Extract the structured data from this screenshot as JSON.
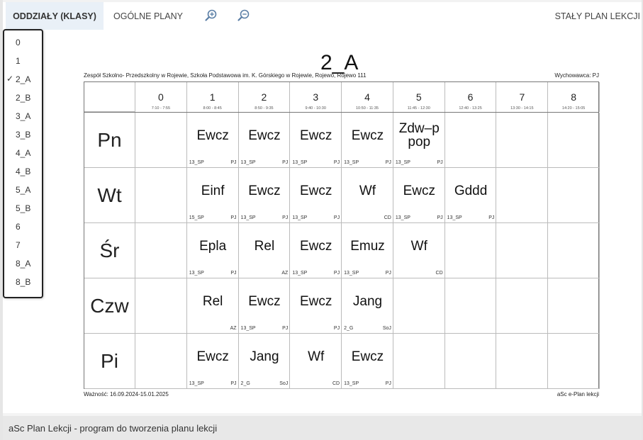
{
  "toolbar": {
    "tab_classes": "ODDZIAŁY (KLASY)",
    "tab_general": "OGÓLNE PLANY",
    "zoom_in_icon": "zoom-in-icon",
    "zoom_out_icon": "zoom-out-icon",
    "permanent_plan": "STAŁY PLAN LEKCJI",
    "accent": "#e9f0f7"
  },
  "dropdown": {
    "items": [
      "0",
      "1",
      "2_A",
      "2_B",
      "3_A",
      "3_B",
      "4_A",
      "4_B",
      "5_A",
      "5_B",
      "6",
      "7",
      "8_A",
      "8_B"
    ],
    "selected": "2_A",
    "check_mark": "✓"
  },
  "timetable": {
    "title": "2_A",
    "school": "Zespół Szkolno- Przedszkolny w Rojewie, Szkoła Podstawowa im. K. Górskiego w Rojewie, Rojewo, Rojewo 111",
    "form_teacher": "Wychowawca: PJ",
    "validity": "Ważność: 16.09.2024-15.01.2025",
    "brand": "aSc e-Plan lekcji",
    "periods": [
      {
        "num": "0",
        "time": "7:10 - 7:55"
      },
      {
        "num": "1",
        "time": "8:00 - 8:45"
      },
      {
        "num": "2",
        "time": "8:50 - 9:35"
      },
      {
        "num": "3",
        "time": "9:40 - 10:30"
      },
      {
        "num": "4",
        "time": "10:50 - 11:35"
      },
      {
        "num": "5",
        "time": "11:45 - 12:30"
      },
      {
        "num": "6",
        "time": "12:40 - 13:25"
      },
      {
        "num": "7",
        "time": "13:30 - 14:15"
      },
      {
        "num": "8",
        "time": "14:20 - 15:05"
      }
    ],
    "days": [
      {
        "name": "Pn",
        "lessons": [
          {
            "period": 1,
            "subject": "Ewcz",
            "room": "13_SP",
            "teacher": "PJ"
          },
          {
            "period": 2,
            "subject": "Ewcz",
            "room": "13_SP",
            "teacher": "PJ"
          },
          {
            "period": 3,
            "subject": "Ewcz",
            "room": "13_SP",
            "teacher": "PJ"
          },
          {
            "period": 4,
            "subject": "Ewcz",
            "room": "13_SP",
            "teacher": "PJ"
          },
          {
            "period": 5,
            "subject": "Zdw–p pop",
            "room": "13_SP",
            "teacher": "PJ"
          }
        ]
      },
      {
        "name": "Wt",
        "lessons": [
          {
            "period": 1,
            "subject": "Einf",
            "room": "15_SP",
            "teacher": "PJ"
          },
          {
            "period": 2,
            "subject": "Ewcz",
            "room": "13_SP",
            "teacher": "PJ"
          },
          {
            "period": 3,
            "subject": "Ewcz",
            "room": "13_SP",
            "teacher": "PJ"
          },
          {
            "period": 4,
            "subject": "Wf",
            "room": "",
            "teacher": "CD"
          },
          {
            "period": 5,
            "subject": "Ewcz",
            "room": "13_SP",
            "teacher": "PJ"
          },
          {
            "period": 6,
            "subject": "Gddd",
            "room": "13_SP",
            "teacher": "PJ"
          }
        ]
      },
      {
        "name": "Śr",
        "lessons": [
          {
            "period": 1,
            "subject": "Epla",
            "room": "13_SP",
            "teacher": "PJ"
          },
          {
            "period": 2,
            "subject": "Rel",
            "room": "",
            "teacher": "AZ"
          },
          {
            "period": 3,
            "subject": "Ewcz",
            "room": "13_SP",
            "teacher": "PJ"
          },
          {
            "period": 4,
            "subject": "Emuz",
            "room": "13_SP",
            "teacher": "PJ"
          },
          {
            "period": 5,
            "subject": "Wf",
            "room": "",
            "teacher": "CD"
          }
        ]
      },
      {
        "name": "Czw",
        "lessons": [
          {
            "period": 1,
            "subject": "Rel",
            "room": "",
            "teacher": "AZ"
          },
          {
            "period": 2,
            "subject": "Ewcz",
            "room": "13_SP",
            "teacher": "PJ"
          },
          {
            "period": 3,
            "subject": "Ewcz",
            "room": "",
            "teacher": "PJ"
          },
          {
            "period": 4,
            "subject": "Jang",
            "room": "2_G",
            "teacher": "SoJ"
          }
        ]
      },
      {
        "name": "Pi",
        "lessons": [
          {
            "period": 1,
            "subject": "Ewcz",
            "room": "13_SP",
            "teacher": "PJ"
          },
          {
            "period": 2,
            "subject": "Jang",
            "room": "2_G",
            "teacher": "SoJ"
          },
          {
            "period": 3,
            "subject": "Wf",
            "room": "",
            "teacher": "CD"
          },
          {
            "period": 4,
            "subject": "Ewcz",
            "room": "13_SP",
            "teacher": "PJ"
          }
        ]
      }
    ]
  },
  "footer": {
    "text": "aSc Plan Lekcji - program do tworzenia planu lekcji"
  }
}
